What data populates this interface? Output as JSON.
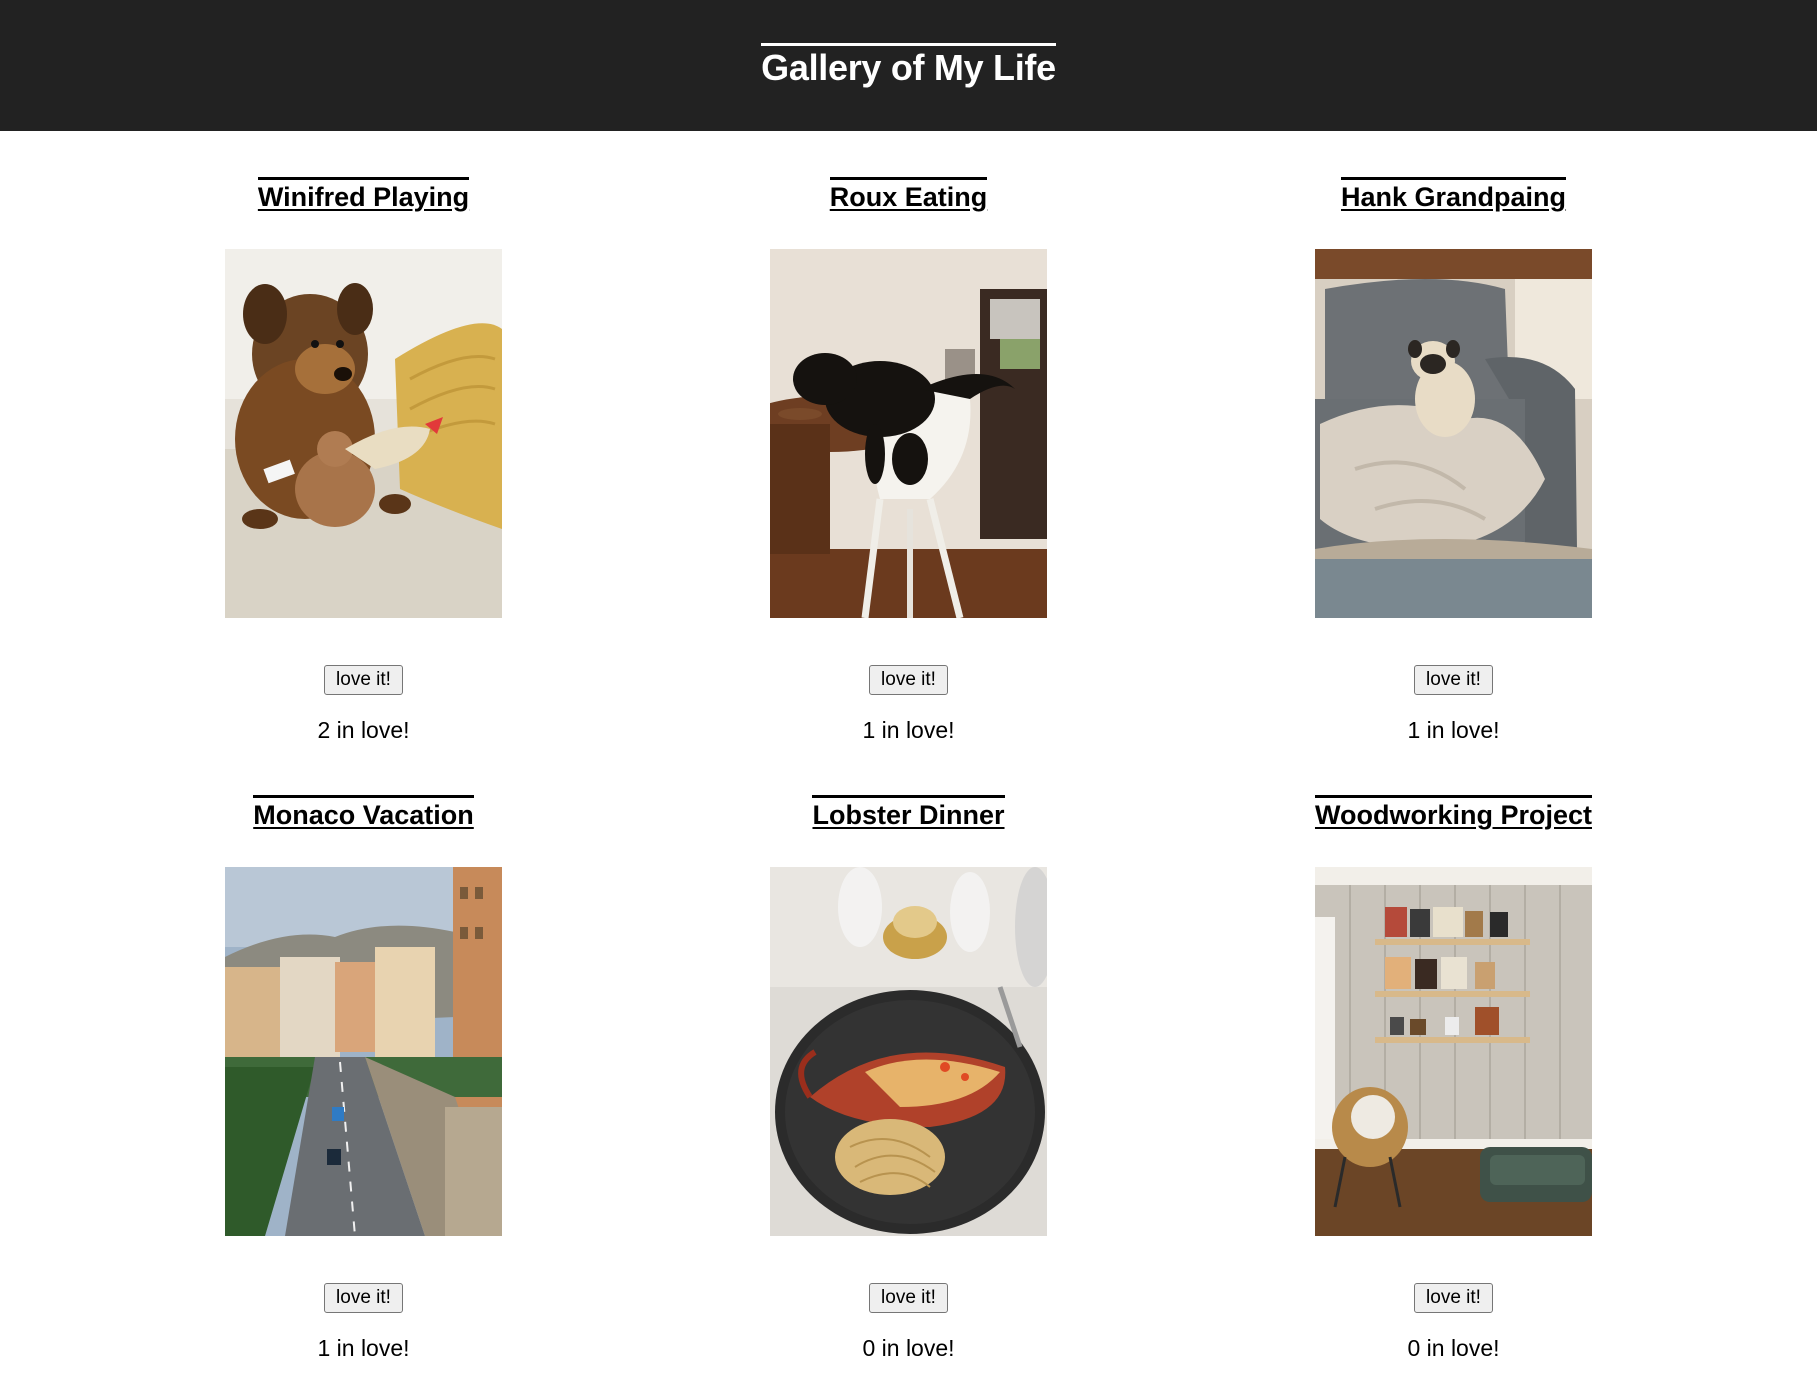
{
  "header": {
    "title": "Gallery of My Life",
    "background": "#222222"
  },
  "gallery": {
    "items": [
      {
        "title": "Winifred Playing",
        "button_label": "love it!",
        "count_text": "2 in love!",
        "image": "dog-with-toy-photo"
      },
      {
        "title": "Roux Eating",
        "button_label": "love it!",
        "count_text": "1 in love!",
        "image": "cat-eating-photo"
      },
      {
        "title": "Hank Grandpaing",
        "button_label": "love it!",
        "count_text": "1 in love!",
        "image": "pug-on-chair-photo"
      },
      {
        "title": "Monaco Vacation",
        "button_label": "love it!",
        "count_text": "1 in love!",
        "image": "monaco-city-photo"
      },
      {
        "title": "Lobster Dinner",
        "button_label": "love it!",
        "count_text": "0 in love!",
        "image": "lobster-pasta-photo"
      },
      {
        "title": "Woodworking Project",
        "button_label": "love it!",
        "count_text": "0 in love!",
        "image": "wall-shelves-photo"
      }
    ]
  }
}
